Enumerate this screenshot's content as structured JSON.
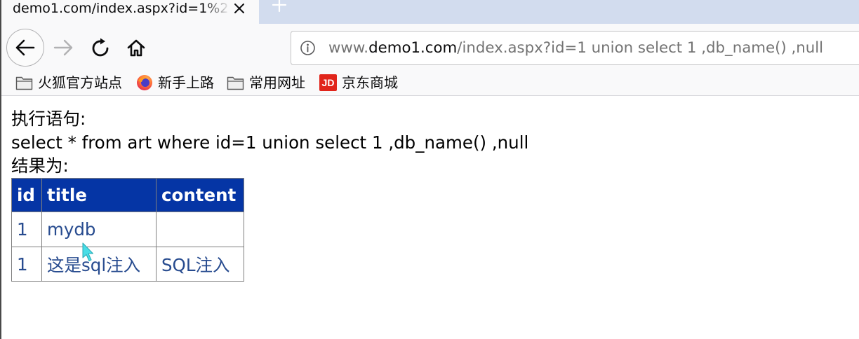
{
  "browser": {
    "tab": {
      "title": "demo1.com/index.aspx?id=1%2",
      "close_icon": "close-icon"
    },
    "new_tab_icon": "plus-icon",
    "toolbar": {
      "back_icon": "back-arrow-icon",
      "forward_icon": "forward-arrow-icon",
      "forward_enabled": false,
      "reload_icon": "reload-icon",
      "home_icon": "home-icon"
    },
    "url": {
      "info_icon": "info-icon",
      "prefix": "www.",
      "domain": "demo1.com",
      "path": "/index.aspx?id=1 union select 1 ,db_name() ,null"
    },
    "bookmarks": [
      {
        "icon": "folder-icon",
        "label": "火狐官方站点"
      },
      {
        "icon": "firefox-icon",
        "label": "新手上路"
      },
      {
        "icon": "folder-icon",
        "label": "常用网址"
      },
      {
        "icon": "jd-logo-icon",
        "icon_text": "JD",
        "label": "京东商城"
      }
    ]
  },
  "page": {
    "exec_label": "执行语句:",
    "sql": "select * from art where id=1 union select 1 ,db_name() ,null",
    "result_label": "结果为:",
    "table": {
      "headers": [
        "id",
        "title",
        "content"
      ],
      "rows": [
        [
          "1",
          "mydb",
          ""
        ],
        [
          "1",
          "这是sql注入",
          "SQL注入"
        ]
      ]
    }
  },
  "colors": {
    "tab_strip": "#d2dcee",
    "toolbar_bg": "#f9f9fa",
    "table_header_bg": "#0535a5",
    "table_header_text": "#ffffff",
    "table_cell_text": "#274b8f",
    "table_border": "#7f7f7f",
    "cursor": "#48dde6"
  }
}
